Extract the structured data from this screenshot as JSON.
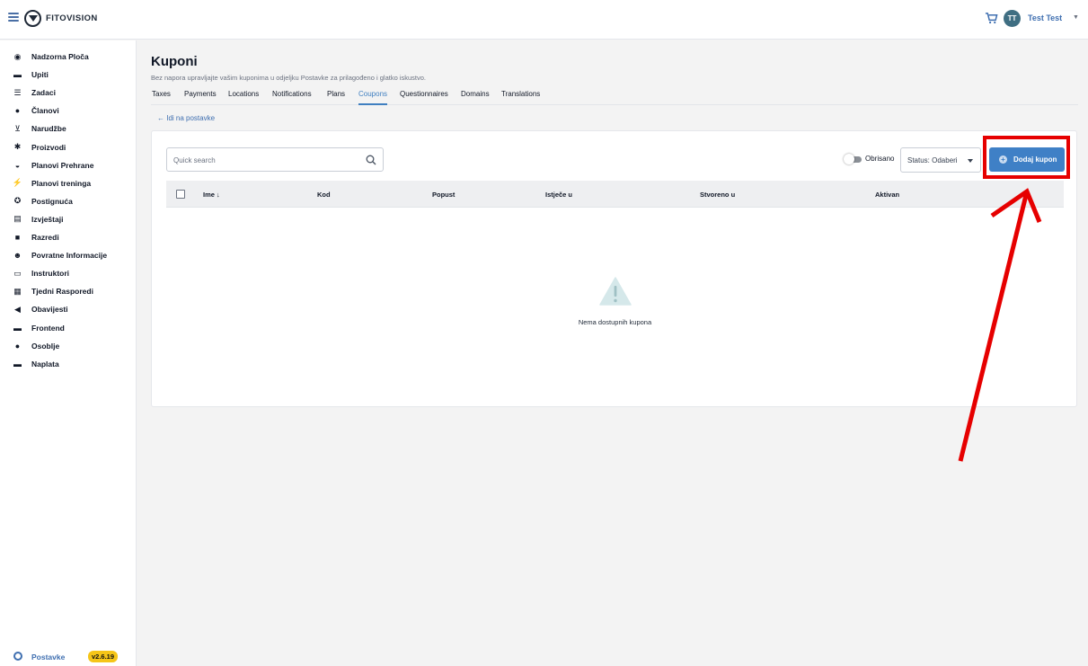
{
  "header": {
    "brand": "FITOVISION",
    "user_initials": "TT",
    "user_name": "Test Test"
  },
  "sidebar": {
    "items": [
      {
        "label": "Nadzorna Ploča",
        "icon": "dashboard-icon"
      },
      {
        "label": "Upiti",
        "icon": "chat-icon"
      },
      {
        "label": "Zadaci",
        "icon": "list-icon"
      },
      {
        "label": "Članovi",
        "icon": "members-icon"
      },
      {
        "label": "Narudžbe",
        "icon": "cart-icon"
      },
      {
        "label": "Proizvodi",
        "icon": "products-icon"
      },
      {
        "label": "Planovi Prehrane",
        "icon": "bowl-icon"
      },
      {
        "label": "Planovi treninga",
        "icon": "running-icon"
      },
      {
        "label": "Postignuća",
        "icon": "award-icon"
      },
      {
        "label": "Izvještaji",
        "icon": "report-icon"
      },
      {
        "label": "Razredi",
        "icon": "book-icon"
      },
      {
        "label": "Povratne Informacije",
        "icon": "smile-icon"
      },
      {
        "label": "Instruktori",
        "icon": "instructor-icon"
      },
      {
        "label": "Tjedni Rasporedi",
        "icon": "calendar-icon"
      },
      {
        "label": "Obavijesti",
        "icon": "megaphone-icon"
      },
      {
        "label": "Frontend",
        "icon": "window-icon"
      },
      {
        "label": "Osoblje",
        "icon": "staff-icon"
      },
      {
        "label": "Naplata",
        "icon": "card-icon"
      }
    ],
    "settings_label": "Postavke",
    "version": "v2.6.19"
  },
  "page": {
    "title": "Kuponi",
    "subtitle": "Bez napora upravljajte vašim kuponima u odjeljku Postavke za prilagođeno i glatko iskustvo.",
    "tabs": [
      "Taxes",
      "Payments",
      "Locations",
      "Notifications",
      "Plans",
      "Coupons",
      "Questionnaires",
      "Domains",
      "Translations"
    ],
    "active_tab": "Coupons",
    "back_link": "Idi na postavke"
  },
  "toolbar": {
    "search_placeholder": "Quick search",
    "deleted_toggle_label": "Obrisano",
    "status_select": "Status: Odaberi",
    "add_button": "Dodaj kupon"
  },
  "table": {
    "columns": [
      "Ime",
      "Kod",
      "Popust",
      "Istječe u",
      "Stvoreno u",
      "Aktivan"
    ],
    "empty_message": "Nema dostupnih kupona"
  },
  "colors": {
    "accent": "#3f80c6",
    "annotation": "#e60000",
    "version_badge": "#f5c518"
  }
}
